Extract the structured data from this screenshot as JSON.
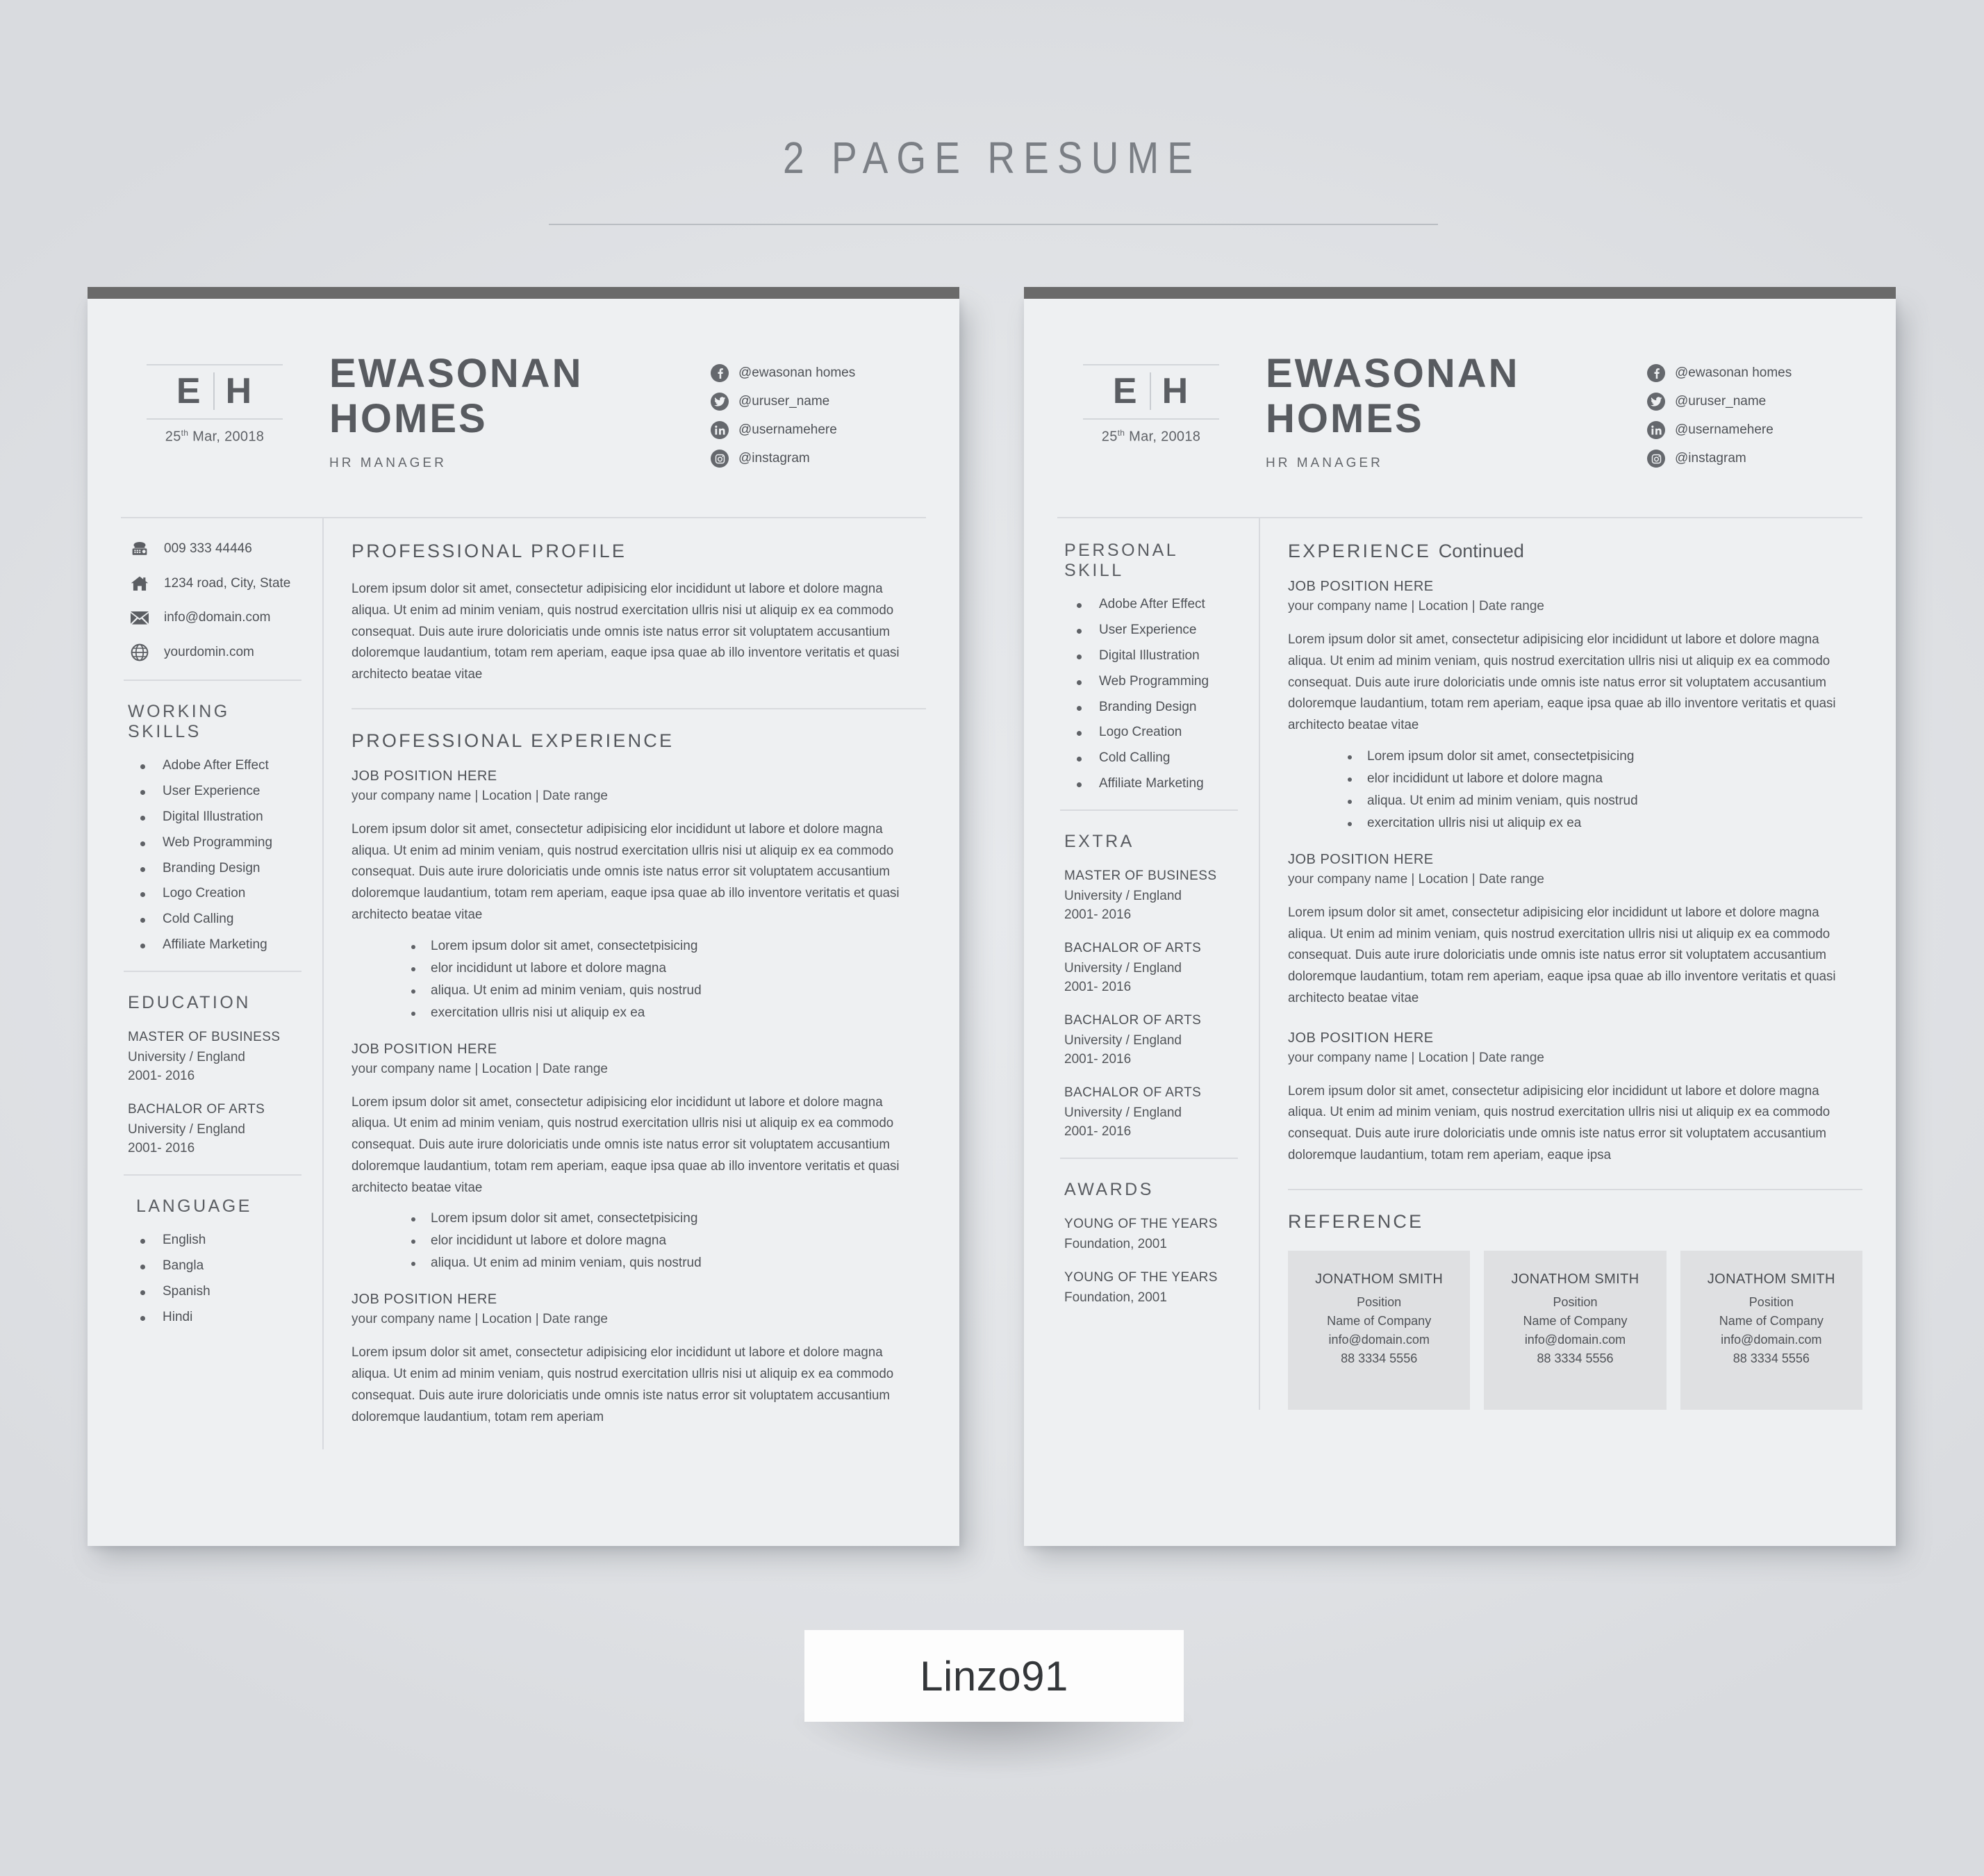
{
  "mockup": {
    "title": "2 PAGE RESUME",
    "brand_label": "Linzo91"
  },
  "colors": {
    "background": "#e2e4e7",
    "page": "#eef0f2",
    "topbar": "#6a6a6a",
    "text": "#4f5257",
    "heading": "#55585d",
    "rule": "#d8dade",
    "ref_card": "#dfe0e2"
  },
  "header": {
    "monogram_left": "E",
    "monogram_right": "H",
    "date_prefix": "25",
    "date_sup": "th",
    "date_rest": " Mar, 20018",
    "name_line1": "EWASONAN",
    "name_line2": "HOMES",
    "role": "HR MANAGER",
    "socials": [
      {
        "icon": "facebook-icon",
        "handle": "@ewasonan homes"
      },
      {
        "icon": "twitter-icon",
        "handle": "@uruser_name"
      },
      {
        "icon": "linkedin-icon",
        "handle": "@usernamehere"
      },
      {
        "icon": "instagram-icon",
        "handle": "@instagram"
      }
    ]
  },
  "contacts": [
    {
      "icon": "telephone-icon",
      "value": "009 333 44446"
    },
    {
      "icon": "home-icon",
      "value": "1234 road, City, State"
    },
    {
      "icon": "envelope-icon",
      "value": "info@domain.com"
    },
    {
      "icon": "globe-icon",
      "value": "yourdomin.com"
    }
  ],
  "page1": {
    "working_skills": {
      "heading": "WORKING SKILLS",
      "items": [
        "Adobe After Effect",
        "User Experience",
        "Digital Illustration",
        "Web Programming",
        "Branding Design",
        "Logo Creation",
        "Cold Calling",
        "Affiliate Marketing"
      ]
    },
    "education": {
      "heading": "EDUCATION",
      "entries": [
        {
          "degree": "MASTER OF BUSINESS",
          "school": "University / England",
          "years": "2001- 2016"
        },
        {
          "degree": "BACHALOR OF ARTS",
          "school": "University / England",
          "years": "2001- 2016"
        }
      ]
    },
    "language": {
      "heading": "LANGUAGE",
      "items": [
        "English",
        "Bangla",
        "Spanish",
        "Hindi"
      ]
    },
    "profile": {
      "heading": "PROFESSIONAL PROFILE",
      "body": "Lorem ipsum dolor sit amet, consectetur adipisicing elor incididunt ut labore et dolore magna aliqua. Ut enim ad minim veniam, quis nostrud exercitation ullris nisi ut aliquip ex ea commodo consequat. Duis aute irure doloriciatis unde omnis iste natus error sit voluptatem accusantium doloremque laudantium, totam rem aperiam, eaque ipsa quae ab illo inventore veritatis et quasi architecto beatae vitae"
    },
    "experience": {
      "heading": "PROFESSIONAL EXPERIENCE",
      "jobs": [
        {
          "title": "JOB POSITION HERE",
          "meta": "your company name | Location | Date range",
          "body": "Lorem ipsum dolor sit amet, consectetur adipisicing elor incididunt ut labore et dolore magna aliqua. Ut enim ad minim veniam, quis nostrud exercitation ullris nisi ut aliquip ex ea commodo consequat. Duis aute irure doloriciatis unde omnis iste natus error sit voluptatem accusantium doloremque laudantium, totam rem aperiam, eaque ipsa quae ab illo inventore veritatis et quasi architecto beatae vitae",
          "bullets": [
            "Lorem ipsum dolor sit amet, consectetpisicing",
            "elor incididunt ut labore et dolore magna",
            "aliqua. Ut enim ad minim veniam, quis nostrud",
            "exercitation ullris nisi ut aliquip ex ea"
          ]
        },
        {
          "title": "JOB POSITION HERE",
          "meta": "your company name | Location | Date range",
          "body": "Lorem ipsum dolor sit amet, consectetur adipisicing elor incididunt ut labore et dolore magna aliqua. Ut enim ad minim veniam, quis nostrud exercitation ullris nisi ut aliquip ex ea commodo consequat. Duis aute irure doloriciatis unde omnis iste natus error sit voluptatem accusantium doloremque laudantium, totam rem aperiam, eaque ipsa quae ab illo inventore veritatis et quasi architecto beatae vitae",
          "bullets": [
            "Lorem ipsum dolor sit amet, consectetpisicing",
            "elor incididunt ut labore et dolore magna",
            "aliqua. Ut enim ad minim veniam, quis nostrud"
          ]
        },
        {
          "title": "JOB POSITION HERE",
          "meta": "your company name | Location | Date range",
          "body": "Lorem ipsum dolor sit amet, consectetur adipisicing elor incididunt ut labore et dolore magna aliqua. Ut enim ad minim veniam, quis nostrud exercitation ullris nisi ut aliquip ex ea commodo consequat. Duis aute irure doloriciatis unde omnis iste natus error sit voluptatem accusantium doloremque laudantium, totam rem aperiam",
          "bullets": []
        }
      ]
    }
  },
  "page2": {
    "personal_skill": {
      "heading": "PERSONAL SKILL",
      "items": [
        "Adobe After Effect",
        "User Experience",
        "Digital Illustration",
        "Web Programming",
        "Branding Design",
        "Logo Creation",
        "Cold Calling",
        "Affiliate Marketing"
      ]
    },
    "extra": {
      "heading": "EXTRA",
      "entries": [
        {
          "degree": "MASTER OF BUSINESS",
          "school": "University / England",
          "years": "2001- 2016"
        },
        {
          "degree": "BACHALOR OF ARTS",
          "school": "University / England",
          "years": "2001- 2016"
        },
        {
          "degree": "BACHALOR OF ARTS",
          "school": "University / England",
          "years": "2001- 2016"
        },
        {
          "degree": "BACHALOR OF ARTS",
          "school": "University / England",
          "years": "2001- 2016"
        }
      ]
    },
    "awards": {
      "heading": "AWARDS",
      "entries": [
        {
          "name": "YOUNG OF THE YEARS",
          "detail": "Foundation, 2001"
        },
        {
          "name": "YOUNG OF THE YEARS",
          "detail": "Foundation, 2001"
        }
      ]
    },
    "experience": {
      "heading_main": "EXPERIENCE",
      "heading_cont": "Continued",
      "jobs": [
        {
          "title": "JOB POSITION HERE",
          "meta": "your company name | Location | Date range",
          "body": "Lorem ipsum dolor sit amet, consectetur adipisicing elor incididunt ut labore et dolore magna aliqua. Ut enim ad minim veniam, quis nostrud exercitation ullris nisi ut aliquip ex ea commodo consequat. Duis aute irure doloriciatis unde omnis iste natus error sit voluptatem accusantium doloremque laudantium, totam rem aperiam, eaque ipsa quae ab illo inventore veritatis et quasi architecto beatae vitae",
          "bullets": [
            "Lorem ipsum dolor sit amet, consectetpisicing",
            "elor incididunt ut labore et dolore magna",
            "aliqua. Ut enim ad minim veniam, quis nostrud",
            "exercitation ullris nisi ut aliquip ex ea"
          ]
        },
        {
          "title": "JOB POSITION HERE",
          "meta": "your company name | Location | Date range",
          "body": "Lorem ipsum dolor sit amet, consectetur adipisicing elor incididunt ut labore et dolore magna aliqua. Ut enim ad minim veniam, quis nostrud exercitation ullris nisi ut aliquip ex ea commodo consequat. Duis aute irure doloriciatis unde omnis iste natus error sit voluptatem accusantium doloremque laudantium, totam rem aperiam, eaque ipsa quae ab illo inventore veritatis et quasi architecto beatae vitae",
          "bullets": []
        },
        {
          "title": "JOB POSITION HERE",
          "meta": "your company name | Location | Date range",
          "body": "Lorem ipsum dolor sit amet, consectetur adipisicing elor incididunt ut labore et dolore magna aliqua. Ut enim ad minim veniam, quis nostrud exercitation ullris nisi ut aliquip ex ea commodo consequat. Duis aute irure doloriciatis unde omnis iste natus error sit voluptatem accusantium doloremque laudantium, totam rem aperiam, eaque ipsa",
          "bullets": []
        }
      ]
    },
    "reference": {
      "heading": "REFERENCE",
      "cards": [
        {
          "name": "JONATHOM SMITH",
          "position": "Position",
          "company": "Name of Company",
          "email": "info@domain.com",
          "phone": "88 3334 5556"
        },
        {
          "name": "JONATHOM SMITH",
          "position": "Position",
          "company": "Name of Company",
          "email": "info@domain.com",
          "phone": "88 3334 5556"
        },
        {
          "name": "JONATHOM SMITH",
          "position": "Position",
          "company": "Name of Company",
          "email": "info@domain.com",
          "phone": "88 3334 5556"
        }
      ]
    }
  }
}
